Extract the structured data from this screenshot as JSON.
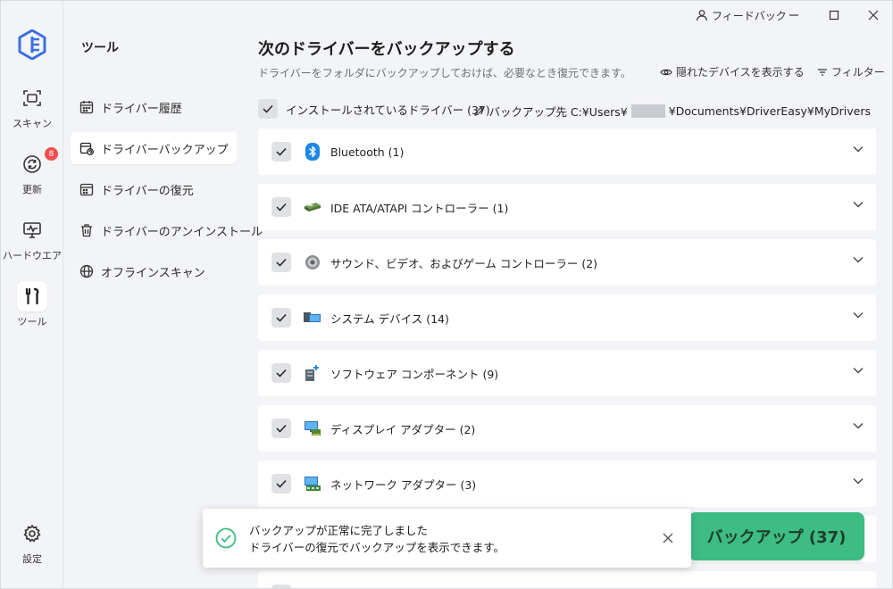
{
  "titlebar": {
    "feedback_label": "フィードバック"
  },
  "rail": {
    "items": [
      {
        "label": "スキャン",
        "icon": "scan-icon"
      },
      {
        "label": "更新",
        "icon": "refresh-icon",
        "badge": "8"
      },
      {
        "label": "ハードウエア",
        "icon": "hardware-icon"
      },
      {
        "label": "ツール",
        "icon": "tools-icon",
        "active": true
      },
      {
        "label": "設定",
        "icon": "gear-icon"
      }
    ]
  },
  "panel": {
    "title": "ツール",
    "items": [
      {
        "label": "ドライバー履歴",
        "icon": "calendar-icon"
      },
      {
        "label": "ドライバーバックアップ",
        "icon": "backup-icon",
        "active": true
      },
      {
        "label": "ドライバーの復元",
        "icon": "restore-icon"
      },
      {
        "label": "ドライバーのアンインストール",
        "icon": "trash-icon"
      },
      {
        "label": "オフラインスキャン",
        "icon": "globe-icon"
      }
    ]
  },
  "main": {
    "title": "次のドライバーをバックアップする",
    "subtitle": "ドライバーをフォルダにバックアップしておけば、必要なとき復元できます。",
    "show_hidden_label": "隠れたデバイスを表示する",
    "filter_label": "フィルター",
    "all_drivers_label": "インストールされているドライバー (37)",
    "dest_label": "バックアップ先 C:¥Users¥",
    "dest_suffix": "¥Documents¥DriverEasy¥MyDrivers",
    "rows": [
      {
        "label": "Bluetooth (1)",
        "icon": "bluetooth-icon",
        "checked": true
      },
      {
        "label": "IDE ATA/ATAPI コントローラー (1)",
        "icon": "ide-controller-icon",
        "checked": true
      },
      {
        "label": "サウンド、ビデオ、およびゲーム コントローラー (2)",
        "icon": "speaker-icon",
        "checked": true
      },
      {
        "label": "システム デバイス (14)",
        "icon": "system-device-icon",
        "checked": true
      },
      {
        "label": "ソフトウェア コンポーネント (9)",
        "icon": "software-component-icon",
        "checked": true
      },
      {
        "label": "ディスプレイ アダプター (2)",
        "icon": "display-adapter-icon",
        "checked": true
      },
      {
        "label": "ネットワーク アダプター (3)",
        "icon": "network-adapter-icon",
        "checked": true
      }
    ],
    "backup_button_label": "バックアップ (37)"
  },
  "toast": {
    "title": "バックアップが正常に完了しました",
    "message": "ドライバーの復元でバックアップを表示できます。"
  },
  "colors": {
    "accent_green": "#3dbd83",
    "logo_blue": "#3b6fe0",
    "badge_red": "#ef4d4d",
    "bluetooth_blue": "#1e88e5"
  }
}
